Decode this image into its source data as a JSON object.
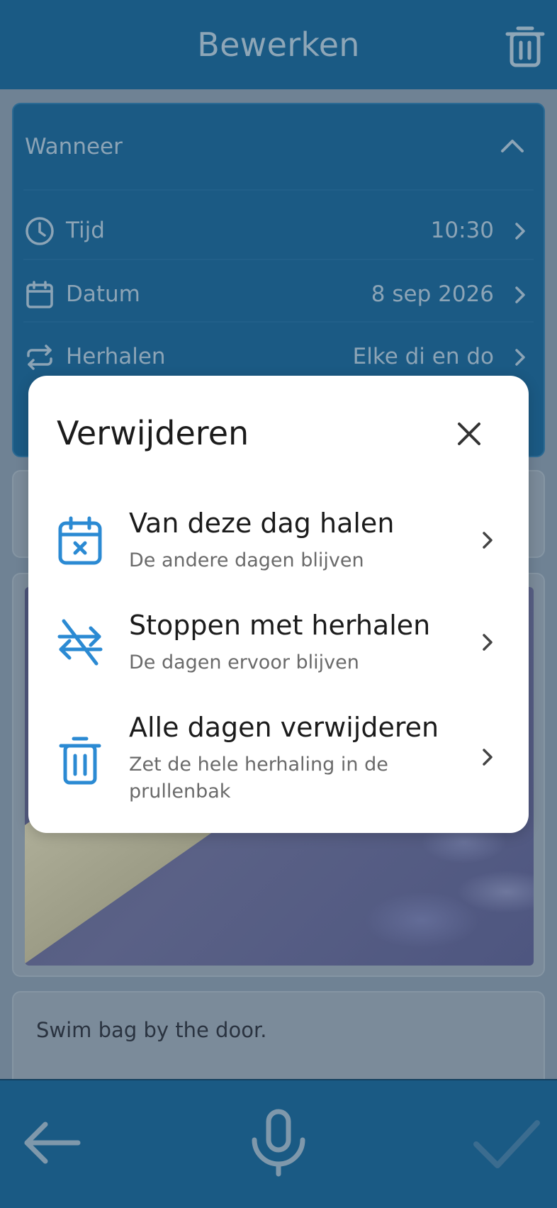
{
  "header": {
    "title": "Bewerken",
    "trash_icon": "trash-icon"
  },
  "when": {
    "heading": "Wanneer",
    "rows": [
      {
        "label": "Tijd",
        "value": "10:30",
        "icon": "clock-icon"
      },
      {
        "label": "Datum",
        "value": "8 sep 2026",
        "icon": "calendar-icon"
      },
      {
        "label": "Herhalen",
        "value": "Elke di en do",
        "icon": "repeat-icon"
      }
    ]
  },
  "note": {
    "text": "Swim bag by the door."
  },
  "modal": {
    "title": "Verwijderen",
    "options": [
      {
        "title": "Van deze dag halen",
        "subtitle": "De andere dagen blijven",
        "icon": "calendar-x-icon"
      },
      {
        "title": "Stoppen met herhalen",
        "subtitle": "De dagen ervoor blijven",
        "icon": "repeat-off-icon"
      },
      {
        "title": "Alle dagen verwijderen",
        "subtitle": "Zet de hele herhaling in de prullenbak",
        "icon": "trash-icon"
      }
    ]
  },
  "colors": {
    "accent": "#2b8ad3",
    "header": "#1a5a84",
    "overlay": "#6f8294",
    "modal_bg": "#ffffff"
  }
}
